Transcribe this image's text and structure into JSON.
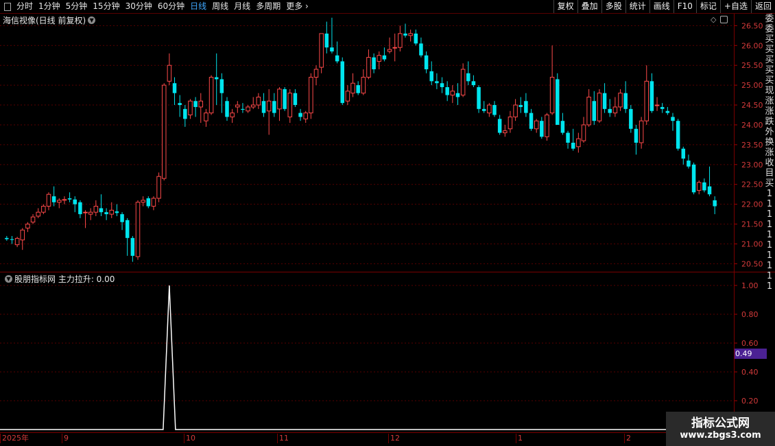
{
  "toolbar": {
    "periods": [
      "分时",
      "1分钟",
      "5分钟",
      "15分钟",
      "30分钟",
      "60分钟",
      "日线",
      "周线",
      "月线",
      "多周期",
      "更多"
    ],
    "active_period": "日线",
    "right_buttons": [
      "复权",
      "叠加",
      "多股",
      "统计",
      "画线",
      "F10",
      "标记",
      "+自选",
      "返回"
    ]
  },
  "main_pane": {
    "title": "海信视像(日线 前复权)",
    "y_ticks": [
      "26.50",
      "26.00",
      "25.50",
      "25.00",
      "24.50",
      "24.00",
      "23.50",
      "23.00",
      "22.50",
      "22.00",
      "21.50",
      "21.00",
      "20.50"
    ]
  },
  "indicator_pane": {
    "title": "股朋指标网 主力拉升: 0.00",
    "y_ticks": [
      "1.00",
      "0.80",
      "0.60",
      "0.40",
      "0.20"
    ],
    "current_value": "0.49"
  },
  "date_axis": {
    "labels": [
      "2025年",
      "9",
      "10",
      "11",
      "12",
      "1",
      "2"
    ]
  },
  "right_strip_chars": [
    "委",
    "委",
    "买",
    "买",
    "买",
    "买",
    "买",
    "现",
    "涨",
    "涨",
    "跌",
    "外",
    "换",
    "涨",
    "收",
    "目",
    "买",
    "1",
    "1",
    "1",
    "1",
    "1",
    "1",
    "1",
    "1",
    "1",
    "1"
  ],
  "watermark": {
    "title": "指标公式网",
    "url": "www.zbgs3.com"
  },
  "colors": {
    "up": "#ff4a4a",
    "down": "#00e5ee",
    "grid": "#5a0000",
    "axis": "#7a0000",
    "indicator_line": "#ffffff"
  },
  "chart_data": [
    {
      "type": "candlestick",
      "title": "海信视像(日线 前复权)",
      "ylim": [
        20.3,
        26.8
      ],
      "ohlc": [
        [
          21.15,
          21.2,
          21.08,
          21.12
        ],
        [
          21.12,
          21.2,
          21.0,
          21.1
        ],
        [
          20.98,
          21.18,
          20.92,
          21.14
        ],
        [
          21.1,
          21.4,
          20.85,
          21.35
        ],
        [
          21.4,
          21.55,
          21.3,
          21.5
        ],
        [
          21.55,
          21.75,
          21.5,
          21.68
        ],
        [
          21.7,
          21.9,
          21.65,
          21.8
        ],
        [
          21.8,
          22.0,
          21.75,
          21.95
        ],
        [
          21.95,
          22.3,
          21.85,
          22.25
        ],
        [
          22.2,
          22.45,
          21.95,
          22.05
        ],
        [
          22.05,
          22.15,
          21.9,
          22.1
        ],
        [
          22.1,
          22.2,
          22.0,
          22.12
        ],
        [
          22.15,
          22.3,
          22.05,
          22.12
        ],
        [
          22.12,
          22.2,
          21.8,
          22.0
        ],
        [
          22.05,
          22.1,
          21.65,
          21.75
        ],
        [
          21.8,
          21.85,
          21.4,
          21.8
        ],
        [
          21.75,
          21.9,
          21.6,
          21.8
        ],
        [
          21.8,
          22.1,
          21.7,
          21.95
        ],
        [
          21.9,
          22.25,
          21.7,
          21.8
        ],
        [
          21.8,
          21.9,
          21.6,
          21.75
        ],
        [
          21.75,
          22.05,
          21.65,
          21.85
        ],
        [
          21.82,
          22.0,
          21.7,
          21.78
        ],
        [
          21.75,
          21.8,
          21.35,
          21.55
        ],
        [
          21.6,
          21.65,
          20.7,
          21.15
        ],
        [
          21.15,
          21.2,
          20.55,
          20.7
        ],
        [
          20.68,
          22.1,
          20.6,
          22.05
        ],
        [
          22.05,
          22.2,
          21.95,
          22.1
        ],
        [
          22.15,
          22.2,
          21.9,
          21.95
        ],
        [
          21.95,
          22.2,
          21.85,
          22.15
        ],
        [
          22.15,
          22.8,
          22.05,
          22.7
        ],
        [
          22.65,
          25.05,
          22.6,
          25.0
        ],
        [
          25.1,
          25.8,
          25.0,
          25.5
        ],
        [
          25.05,
          25.2,
          24.5,
          24.8
        ],
        [
          24.55,
          24.75,
          24.2,
          24.5
        ],
        [
          24.4,
          24.5,
          23.95,
          24.15
        ],
        [
          24.25,
          24.65,
          24.15,
          24.6
        ],
        [
          24.6,
          24.7,
          24.2,
          24.45
        ],
        [
          24.45,
          24.8,
          24.05,
          24.6
        ],
        [
          24.1,
          24.4,
          23.95,
          24.3
        ],
        [
          24.3,
          25.25,
          24.25,
          25.2
        ],
        [
          25.2,
          25.8,
          24.5,
          25.15
        ],
        [
          25.15,
          25.3,
          24.3,
          24.8
        ],
        [
          24.6,
          24.7,
          24.1,
          24.2
        ],
        [
          24.2,
          24.4,
          24.05,
          24.3
        ],
        [
          24.45,
          24.6,
          24.3,
          24.5
        ],
        [
          24.4,
          24.55,
          24.3,
          24.38
        ],
        [
          24.35,
          24.5,
          24.3,
          24.45
        ],
        [
          24.45,
          24.7,
          24.4,
          24.5
        ],
        [
          24.5,
          24.8,
          24.4,
          24.7
        ],
        [
          24.6,
          24.8,
          24.2,
          24.3
        ],
        [
          24.35,
          24.9,
          23.75,
          24.6
        ],
        [
          24.6,
          24.8,
          24.2,
          24.3
        ],
        [
          24.4,
          24.95,
          24.1,
          24.9
        ],
        [
          24.9,
          24.95,
          24.35,
          24.4
        ],
        [
          24.2,
          24.9,
          24.05,
          24.8
        ],
        [
          24.8,
          24.9,
          24.45,
          24.5
        ],
        [
          24.3,
          24.4,
          24.1,
          24.2
        ],
        [
          24.15,
          24.35,
          24.05,
          24.3
        ],
        [
          24.3,
          25.3,
          24.15,
          25.2
        ],
        [
          25.2,
          25.5,
          25.0,
          25.4
        ],
        [
          25.45,
          26.2,
          25.3,
          26.3
        ],
        [
          26.3,
          26.6,
          25.8,
          25.95
        ],
        [
          25.95,
          26.7,
          25.8,
          25.85
        ],
        [
          25.75,
          26.1,
          25.55,
          25.6
        ],
        [
          25.6,
          25.7,
          24.5,
          24.55
        ],
        [
          24.6,
          25.0,
          24.5,
          24.85
        ],
        [
          24.8,
          25.3,
          24.7,
          25.05
        ],
        [
          25.0,
          25.1,
          24.75,
          24.8
        ],
        [
          24.8,
          25.4,
          24.75,
          25.2
        ],
        [
          25.2,
          25.9,
          25.15,
          25.7
        ],
        [
          25.7,
          25.8,
          25.3,
          25.4
        ],
        [
          25.6,
          25.85,
          25.4,
          25.75
        ],
        [
          25.75,
          25.95,
          25.6,
          25.65
        ],
        [
          25.85,
          26.2,
          25.8,
          25.9
        ],
        [
          25.95,
          26.3,
          25.6,
          25.95
        ],
        [
          25.95,
          26.5,
          25.85,
          26.3
        ],
        [
          26.3,
          26.55,
          26.2,
          26.25
        ],
        [
          26.25,
          26.4,
          26.1,
          26.3
        ],
        [
          26.3,
          26.4,
          26.0,
          26.05
        ],
        [
          26.05,
          26.2,
          25.7,
          25.75
        ],
        [
          25.75,
          25.85,
          25.3,
          25.4
        ],
        [
          25.35,
          25.6,
          25.0,
          25.1
        ],
        [
          25.1,
          25.3,
          24.9,
          25.05
        ],
        [
          25.05,
          25.2,
          24.8,
          24.95
        ],
        [
          24.95,
          25.1,
          24.6,
          24.75
        ],
        [
          24.75,
          25.0,
          24.55,
          24.85
        ],
        [
          24.8,
          25.05,
          24.5,
          24.7
        ],
        [
          24.75,
          25.55,
          24.7,
          25.4
        ],
        [
          25.3,
          25.6,
          25.0,
          25.1
        ],
        [
          25.1,
          25.25,
          24.95,
          25.0
        ],
        [
          24.95,
          25.0,
          24.3,
          24.4
        ],
        [
          24.4,
          24.6,
          24.3,
          24.35
        ],
        [
          24.3,
          24.55,
          24.2,
          24.5
        ],
        [
          24.5,
          24.6,
          24.2,
          24.25
        ],
        [
          24.15,
          24.25,
          23.75,
          23.8
        ],
        [
          23.8,
          24.0,
          23.7,
          23.85
        ],
        [
          23.9,
          24.35,
          23.8,
          24.2
        ],
        [
          24.2,
          24.65,
          24.1,
          24.5
        ],
        [
          24.5,
          24.7,
          24.3,
          24.45
        ],
        [
          24.6,
          24.8,
          24.2,
          24.3
        ],
        [
          24.3,
          24.4,
          23.85,
          23.9
        ],
        [
          23.9,
          24.15,
          23.8,
          24.1
        ],
        [
          24.1,
          24.2,
          23.65,
          23.7
        ],
        [
          23.7,
          24.3,
          23.6,
          24.25
        ],
        [
          24.3,
          26.0,
          24.25,
          25.2
        ],
        [
          25.15,
          25.3,
          24.1,
          24.0
        ],
        [
          24.1,
          24.3,
          23.75,
          23.8
        ],
        [
          23.8,
          23.85,
          23.4,
          23.55
        ],
        [
          23.55,
          23.9,
          23.35,
          23.4
        ],
        [
          23.45,
          23.8,
          23.3,
          23.65
        ],
        [
          23.6,
          24.2,
          23.55,
          24.0
        ],
        [
          24.0,
          24.9,
          23.95,
          24.7
        ],
        [
          24.6,
          24.85,
          24.0,
          24.1
        ],
        [
          24.1,
          24.9,
          24.05,
          24.8
        ],
        [
          24.8,
          25.05,
          24.3,
          24.4
        ],
        [
          24.4,
          24.65,
          24.2,
          24.3
        ],
        [
          24.3,
          24.7,
          24.2,
          24.45
        ],
        [
          24.45,
          24.9,
          24.35,
          24.8
        ],
        [
          24.8,
          25.1,
          24.3,
          24.4
        ],
        [
          24.4,
          24.5,
          23.8,
          23.9
        ],
        [
          23.9,
          24.0,
          23.25,
          23.55
        ],
        [
          23.55,
          24.2,
          23.4,
          24.1
        ],
        [
          24.1,
          25.5,
          24.0,
          25.1
        ],
        [
          25.1,
          25.3,
          24.3,
          24.35
        ],
        [
          24.5,
          24.7,
          24.35,
          24.5
        ],
        [
          24.45,
          24.55,
          24.3,
          24.4
        ],
        [
          24.35,
          24.45,
          24.25,
          24.3
        ],
        [
          24.2,
          24.3,
          23.85,
          24.1
        ],
        [
          24.1,
          24.15,
          23.35,
          23.4
        ],
        [
          23.4,
          23.45,
          23.0,
          23.15
        ],
        [
          23.1,
          23.25,
          22.9,
          22.95
        ],
        [
          23.0,
          23.05,
          22.25,
          22.3
        ],
        [
          22.35,
          22.6,
          22.25,
          22.55
        ],
        [
          22.55,
          22.65,
          22.3,
          22.35
        ],
        [
          22.45,
          22.95,
          22.2,
          22.25
        ],
        [
          22.1,
          22.2,
          21.75,
          21.95
        ]
      ]
    },
    {
      "type": "line",
      "title": "股朋指标网 主力拉升: 0.00",
      "ylim": [
        0,
        1.0
      ],
      "spike_index": 31,
      "spike_value": 1.0,
      "baseline": 0.0
    }
  ]
}
